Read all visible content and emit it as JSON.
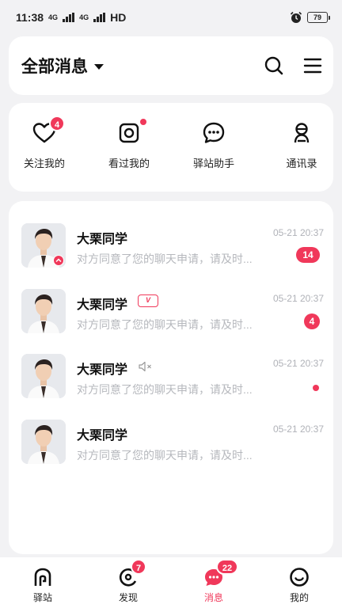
{
  "status_bar": {
    "time": "11:38",
    "network_1": "4G",
    "network_2": "4G",
    "hd": "HD",
    "battery": "79",
    "icons": [
      "signal-icon",
      "alarm-icon",
      "battery-icon"
    ]
  },
  "header": {
    "title": "全部消息",
    "icons": [
      "dropdown-caret-icon",
      "search-icon",
      "menu-icon"
    ]
  },
  "quick_tabs": [
    {
      "label": "关注我的",
      "icon": "heart-icon",
      "badge": "4"
    },
    {
      "label": "看过我的",
      "icon": "camera-icon",
      "dot": true
    },
    {
      "label": "驿站助手",
      "icon": "chat-bubble-icon"
    },
    {
      "label": "通讯录",
      "icon": "contacts-icon"
    }
  ],
  "messages": [
    {
      "name": "大栗同学",
      "preview": "对方同意了您的聊天申请，请及时...",
      "time": "05-21 20:37",
      "badge": "14",
      "avatar_mark": "chevron-up-icon"
    },
    {
      "name": "大栗同学",
      "preview": "对方同意了您的聊天申请，请及时...",
      "time": "05-21 20:37",
      "badge": "4",
      "tag": "vip-icon"
    },
    {
      "name": "大栗同学",
      "preview": "对方同意了您的聊天申请，请及时...",
      "time": "05-21 20:37",
      "dot": true,
      "tag": "mute-icon"
    },
    {
      "name": "大栗同学",
      "preview": "对方同意了您的聊天申请，请及时...",
      "time": "05-21 20:37"
    }
  ],
  "bottom_nav": [
    {
      "label": "驿站",
      "icon": "station-icon"
    },
    {
      "label": "发现",
      "icon": "discover-icon",
      "badge": "7"
    },
    {
      "label": "消息",
      "icon": "message-icon",
      "badge": "22",
      "active": true
    },
    {
      "label": "我的",
      "icon": "profile-icon"
    }
  ],
  "colors": {
    "accent": "#f0385a",
    "background": "#f2f2f4",
    "muted_text": "#b6b8bd"
  }
}
